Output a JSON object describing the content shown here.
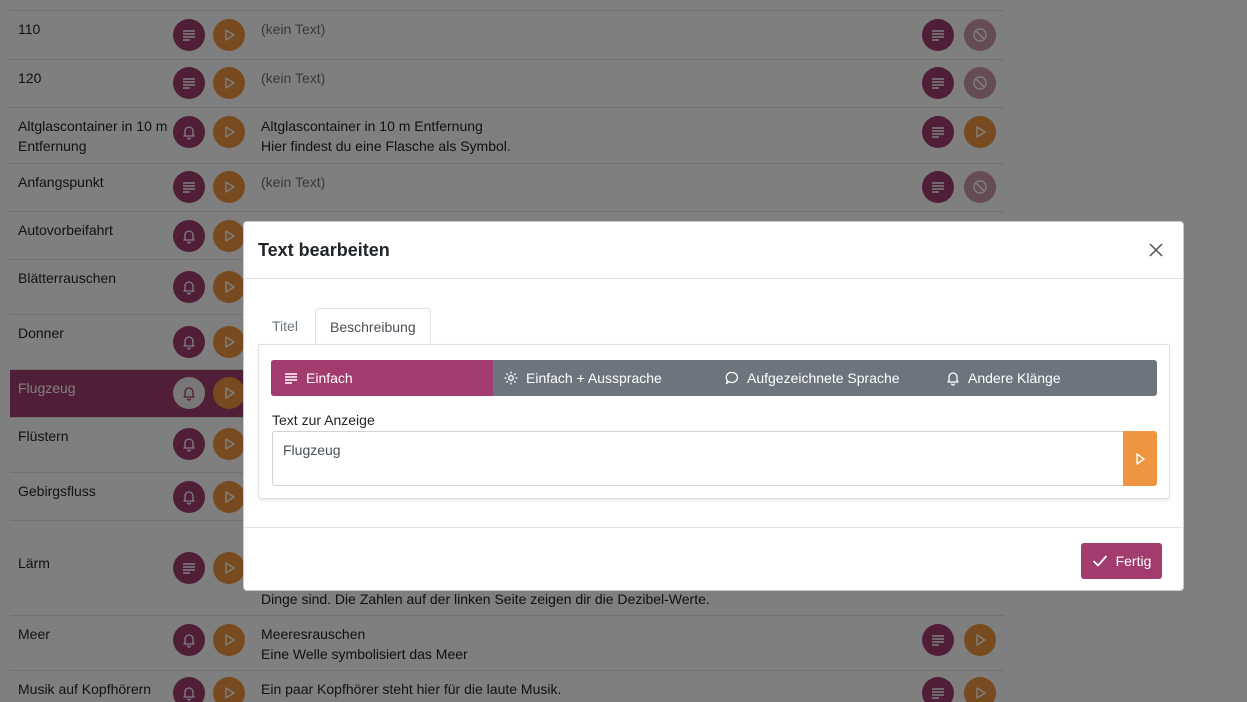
{
  "rows": [
    {
      "name": "110",
      "text": "(kein Text)"
    },
    {
      "name": "120",
      "text": "(kein Text)"
    },
    {
      "name": "Altglascontainer in 10 m Entfernung",
      "text": "Altglascontainer in 10 m Entfernung\nHier findest du eine Flasche als Symbol."
    },
    {
      "name": "Anfangspunkt",
      "text": "(kein Text)"
    },
    {
      "name": "Autovorbeifahrt",
      "text": ""
    },
    {
      "name": "Blätterrauschen",
      "text": ""
    },
    {
      "name": "Donner",
      "text": ""
    },
    {
      "name": "Flugzeug",
      "text": ""
    },
    {
      "name": "Flüstern",
      "text": ""
    },
    {
      "name": "Gebirgsfluss",
      "text": ""
    },
    {
      "name": "Lärm",
      "text": "Dinge sind. Die Zahlen auf der linken Seite zeigen dir die Dezibel-Werte."
    },
    {
      "name": "Meer",
      "text": "Meeresrauschen\nEine Welle symbolisiert das Meer"
    },
    {
      "name": "Musik auf Kopfhörern",
      "text": "Ein paar Kopfhörer steht hier für die laute Musik."
    }
  ],
  "modal": {
    "title": "Text bearbeiten",
    "tabs": [
      "Titel",
      "Beschreibung"
    ],
    "modes": [
      "Einfach",
      "Einfach + Aussprache",
      "Aufgezeichnete Sprache",
      "Andere Klänge"
    ],
    "field_label": "Text zur Anzeige",
    "field_value": "Flugzeug",
    "done_label": "Fertig"
  },
  "colors": {
    "plum": "#a33c6e",
    "orange": "#f0953f",
    "gray": "#6c757d"
  }
}
